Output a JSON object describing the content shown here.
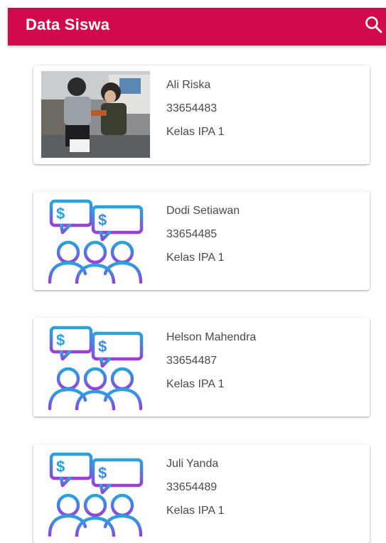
{
  "app_bar": {
    "title": "Data Siswa",
    "search_icon": "search-icon",
    "background": "#d10a4b"
  },
  "students": [
    {
      "name": "Ali Riska",
      "nis": "33654483",
      "kelas": "Kelas IPA 1",
      "avatar": "photo"
    },
    {
      "name": "Dodi Setiawan",
      "nis": "33654485",
      "kelas": "Kelas IPA 1",
      "avatar": "people-chat-icon"
    },
    {
      "name": "Helson Mahendra",
      "nis": "33654487",
      "kelas": "Kelas IPA 1",
      "avatar": "people-chat-icon"
    },
    {
      "name": "Juli Yanda",
      "nis": "33654489",
      "kelas": "Kelas IPA 1",
      "avatar": "people-chat-icon"
    }
  ],
  "colors": {
    "icon_blue": "#2aa3dc",
    "icon_purple": "#9b3fd8"
  }
}
